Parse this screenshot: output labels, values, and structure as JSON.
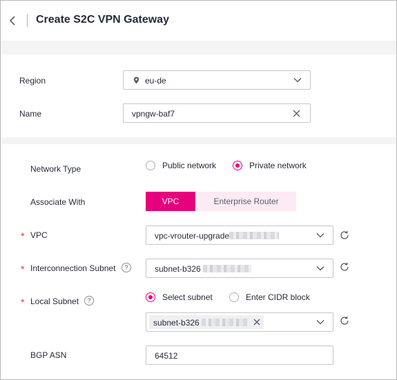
{
  "header": {
    "title": "Create S2C VPN Gateway"
  },
  "basic": {
    "region": {
      "label": "Region",
      "value": "eu-de"
    },
    "name": {
      "label": "Name",
      "value": "vpngw-baf7"
    }
  },
  "network": {
    "network_type": {
      "label": "Network Type",
      "options": [
        "Public network",
        "Private network"
      ],
      "selected": "Private network"
    },
    "associate_with": {
      "label": "Associate With",
      "options": [
        "VPC",
        "Enterprise Router"
      ],
      "selected": "VPC"
    },
    "vpc": {
      "label": "VPC",
      "value": "vpc-vrouter-upgrade"
    },
    "interconnection_subnet": {
      "label": "Interconnection Subnet",
      "value": "subnet-b326"
    },
    "local_subnet": {
      "label": "Local Subnet",
      "options": [
        "Select subnet",
        "Enter CIDR block"
      ],
      "selected": "Select subnet",
      "tag": "subnet-b326"
    },
    "bgp_asn": {
      "label": "BGP ASN",
      "placeholder": "64512"
    }
  },
  "colors": {
    "accent": "#e6007e",
    "required": "#e5312e"
  },
  "icons": [
    "back-arrow-icon",
    "location-pin-icon",
    "chevron-down-icon",
    "clear-icon",
    "refresh-icon",
    "help-icon",
    "tag-close-icon"
  ]
}
